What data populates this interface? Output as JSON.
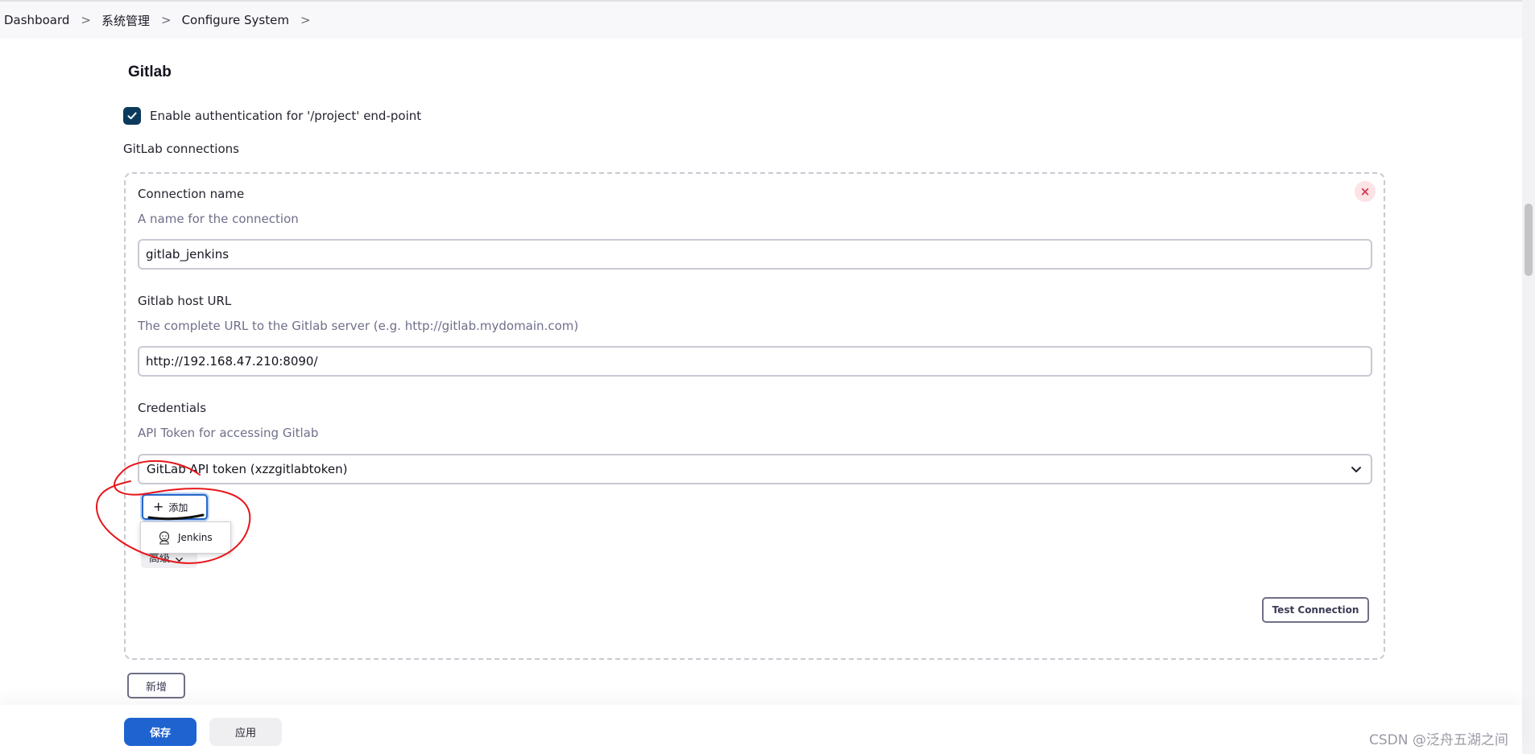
{
  "breadcrumb": {
    "items": [
      "Dashboard",
      "系统管理",
      "Configure System"
    ],
    "separator": ">"
  },
  "section": {
    "title": "Gitlab",
    "enable_auth": {
      "label": "Enable authentication for '/project' end-point",
      "checked": true
    },
    "connections_label": "GitLab connections"
  },
  "connection": {
    "name_label": "Connection name",
    "name_help": "A name for the connection",
    "name_value": "gitlab_jenkins",
    "host_label": "Gitlab host URL",
    "host_help": "The complete URL to the Gitlab server (e.g. http://gitlab.mydomain.com)",
    "host_value": "http://192.168.47.210:8090/",
    "credentials_label": "Credentials",
    "credentials_help": "API Token for accessing Gitlab",
    "credentials_selected": "GitLab API token (xzzgitlabtoken)",
    "add_label": "添加",
    "add_menu_item": "Jenkins",
    "advanced_label": "高级",
    "test_connection_label": "Test Connection",
    "delete_label": "×"
  },
  "new_button_label": "新增",
  "footer": {
    "save_label": "保存",
    "apply_label": "应用"
  },
  "watermark": "CSDN @泛舟五湖之间",
  "colors": {
    "primary": "#1f63d1",
    "checkbox": "#0b3a5c",
    "annotation": "#e8161b"
  }
}
